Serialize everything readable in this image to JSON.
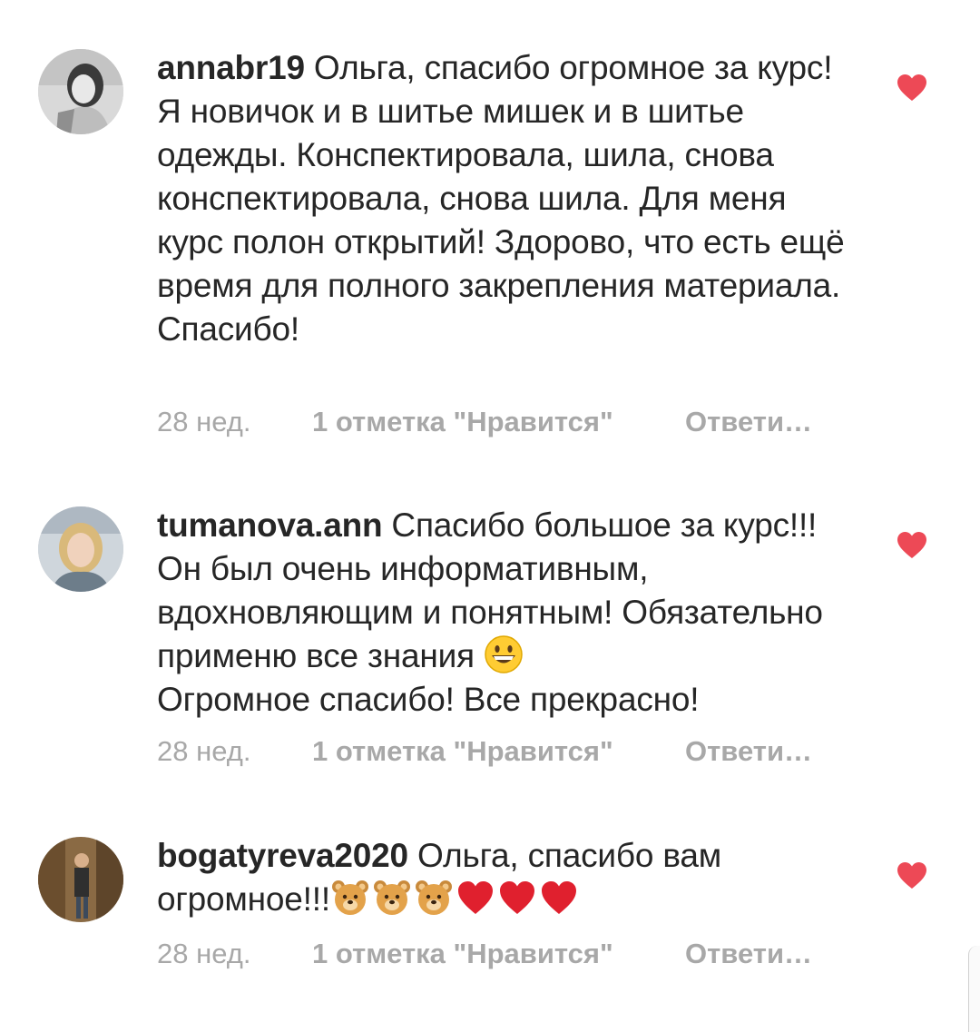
{
  "comments": [
    {
      "username": "annabr19",
      "text": "Ольга, спасибо огромное за курс! Я новичок и в шитье мишек и в шитье одежды. Конспектировала, шила, снова конспектировала, снова шила. Для меня курс полон открытий! Здорово, что есть ещё время для полного закрепления материала. Спасибо!",
      "time": "28 нед.",
      "likes": "1 отметка \"Нравится\"",
      "reply": "Ответи…",
      "liked": true,
      "avatar_icon": "profile-photo-woman-dark-hair"
    },
    {
      "username": "tumanova.ann",
      "text": "Спасибо большое за курс!!! Он был очень информативным, вдохновляющим и понятным! Обязательно применю все знания",
      "text_tail": "Огромное спасибо! Все прекрасно!",
      "emoji": "grinning-face",
      "time": "28 нед.",
      "likes": "1 отметка \"Нравится\"",
      "reply": "Ответи…",
      "liked": true,
      "avatar_icon": "profile-photo-woman-blonde"
    },
    {
      "username": "bogatyreva2020",
      "text": "Ольга, спасибо вам огромное!!!",
      "emojis": [
        "bear-face",
        "bear-face",
        "bear-face",
        "red-heart",
        "red-heart",
        "red-heart"
      ],
      "time": "28 нед.",
      "likes": "1 отметка \"Нравится\"",
      "reply": "Ответи…",
      "liked": true,
      "avatar_icon": "profile-photo-standing-person"
    }
  ],
  "colors": {
    "text": "#262626",
    "meta": "#a8a8a8",
    "heart": "#ed4956"
  }
}
